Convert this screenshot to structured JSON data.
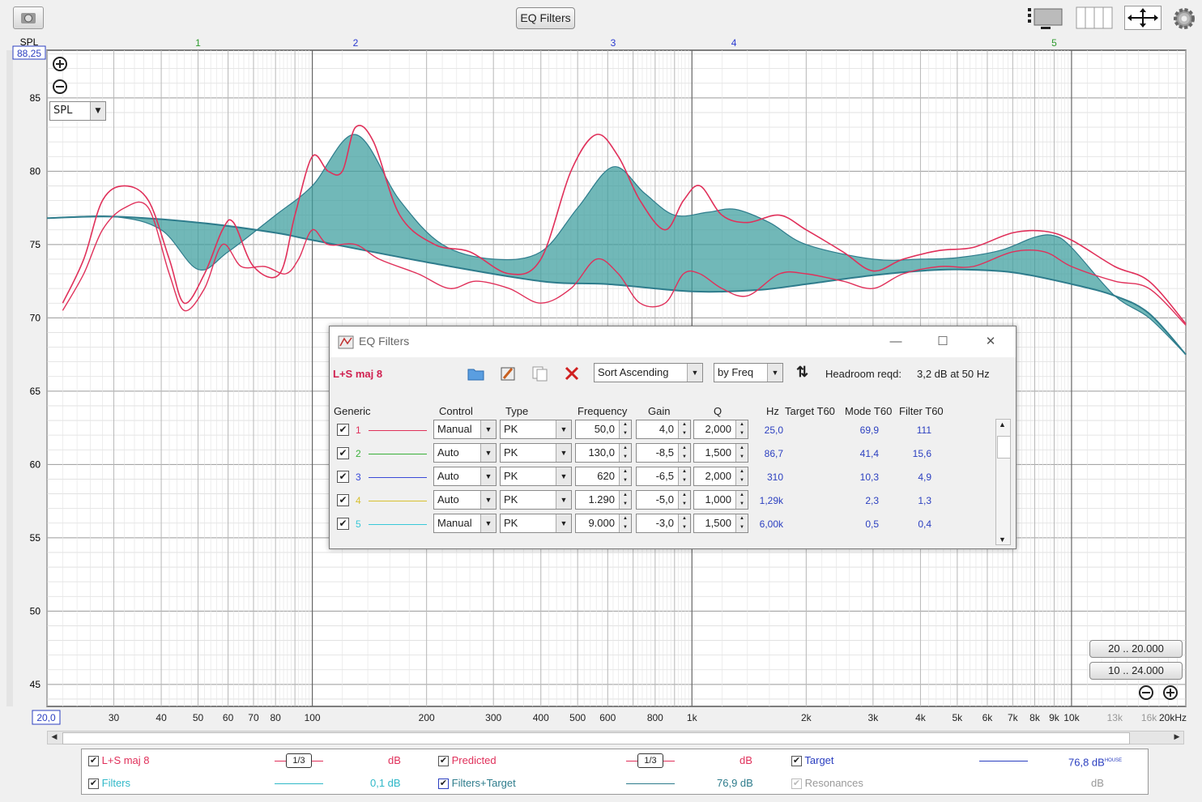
{
  "toolbar": {
    "eq_filters_label": "EQ Filters",
    "icons": [
      "camera-icon",
      "layout-icon",
      "columns-icon",
      "move-icon",
      "gear-icon"
    ]
  },
  "graph": {
    "spl_label": "SPL",
    "y_top_value": "88,25",
    "x_left_value": "20,0",
    "y_ticks": [
      "85",
      "80",
      "75",
      "70",
      "65",
      "60",
      "55",
      "50",
      "45"
    ],
    "x_ticks": [
      "30",
      "40",
      "50",
      "60",
      "70",
      "80",
      "100",
      "200",
      "300",
      "400",
      "500",
      "600",
      "800",
      "1k",
      "2k",
      "3k",
      "4k",
      "5k",
      "6k",
      "7k",
      "8k",
      "9k",
      "10k",
      "13k",
      "16k",
      "20kHz"
    ],
    "filter_markers": [
      {
        "label": "1",
        "hz": 50,
        "color": "#2e9a2e"
      },
      {
        "label": "2",
        "hz": 130,
        "color": "#2a3ad0"
      },
      {
        "label": "3",
        "hz": 620,
        "color": "#2a3ad0"
      },
      {
        "label": "4",
        "hz": 1290,
        "color": "#2a3ad0"
      },
      {
        "label": "5",
        "hz": 9000,
        "color": "#2e9a2e"
      }
    ],
    "mode_select": "SPL",
    "zoom_buttons": [
      "20 .. 20.000",
      "10 .. 24.000"
    ],
    "colors": {
      "measured": "#e0305a",
      "filled": "#3a9c9c",
      "target": "#2e7c8c"
    }
  },
  "chart_data": {
    "type": "line",
    "xlabel": "",
    "ylabel": "SPL",
    "xscale": "log",
    "xlim": [
      20,
      20000
    ],
    "ylim": [
      43.5,
      88.25
    ],
    "series": [
      {
        "name": "L+S maj 8",
        "points": [
          [
            22,
            71
          ],
          [
            25,
            74
          ],
          [
            28,
            78
          ],
          [
            32,
            79
          ],
          [
            37,
            78
          ],
          [
            42,
            74
          ],
          [
            46,
            71
          ],
          [
            52,
            73
          ],
          [
            58,
            76
          ],
          [
            62,
            76.5
          ],
          [
            70,
            73.5
          ],
          [
            82,
            73
          ],
          [
            90,
            77
          ],
          [
            100,
            81
          ],
          [
            110,
            80
          ],
          [
            120,
            80
          ],
          [
            130,
            83
          ],
          [
            145,
            82
          ],
          [
            170,
            77
          ],
          [
            210,
            75
          ],
          [
            260,
            74.5
          ],
          [
            330,
            73
          ],
          [
            400,
            74
          ],
          [
            480,
            80
          ],
          [
            560,
            82.5
          ],
          [
            640,
            81
          ],
          [
            730,
            78
          ],
          [
            850,
            76
          ],
          [
            950,
            78
          ],
          [
            1050,
            79
          ],
          [
            1200,
            77
          ],
          [
            1400,
            76.5
          ],
          [
            1700,
            77
          ],
          [
            2000,
            76
          ],
          [
            2500,
            74.5
          ],
          [
            3000,
            73.2
          ],
          [
            3600,
            74
          ],
          [
            4500,
            74.6
          ],
          [
            5500,
            74.8
          ],
          [
            7000,
            75.8
          ],
          [
            8500,
            75.9
          ],
          [
            10000,
            75.3
          ],
          [
            13000,
            73.5
          ],
          [
            16000,
            72.5
          ],
          [
            20000,
            69.6
          ]
        ]
      },
      {
        "name": "Predicted",
        "points": [
          [
            22,
            70.5
          ],
          [
            25,
            73
          ],
          [
            28,
            76
          ],
          [
            32,
            77.5
          ],
          [
            37,
            77.5
          ],
          [
            42,
            73
          ],
          [
            46,
            70.5
          ],
          [
            52,
            72
          ],
          [
            58,
            75
          ],
          [
            65,
            73.5
          ],
          [
            75,
            73.5
          ],
          [
            85,
            73
          ],
          [
            92,
            74
          ],
          [
            100,
            76
          ],
          [
            110,
            75
          ],
          [
            130,
            75
          ],
          [
            150,
            74
          ],
          [
            190,
            73
          ],
          [
            230,
            72
          ],
          [
            270,
            72.5
          ],
          [
            330,
            72
          ],
          [
            400,
            71
          ],
          [
            480,
            72
          ],
          [
            560,
            74
          ],
          [
            640,
            73
          ],
          [
            730,
            71
          ],
          [
            850,
            71
          ],
          [
            950,
            73
          ],
          [
            1050,
            73
          ],
          [
            1200,
            72
          ],
          [
            1400,
            71.5
          ],
          [
            1700,
            73
          ],
          [
            2000,
            73
          ],
          [
            2500,
            72.5
          ],
          [
            3000,
            72
          ],
          [
            3600,
            73
          ],
          [
            4500,
            73.5
          ],
          [
            5500,
            73.5
          ],
          [
            7000,
            74.5
          ],
          [
            8500,
            74.5
          ],
          [
            10000,
            73.5
          ],
          [
            13000,
            72.5
          ],
          [
            16000,
            72
          ],
          [
            20000,
            69.5
          ]
        ]
      },
      {
        "name": "Target",
        "points": [
          [
            20,
            76.8
          ],
          [
            30,
            76.9
          ],
          [
            50,
            76.5
          ],
          [
            80,
            75.8
          ],
          [
            100,
            75.3
          ],
          [
            200,
            73.8
          ],
          [
            400,
            72.5
          ],
          [
            600,
            72.3
          ],
          [
            1000,
            71.8
          ],
          [
            1500,
            71.9
          ],
          [
            2000,
            72.3
          ],
          [
            3000,
            72.9
          ],
          [
            4000,
            73.2
          ],
          [
            5000,
            73.3
          ],
          [
            7000,
            73.1
          ],
          [
            10000,
            72.3
          ],
          [
            13000,
            71.5
          ],
          [
            16000,
            70.3
          ],
          [
            20000,
            67.5
          ]
        ]
      },
      {
        "name": "Filters+Target",
        "points": [
          [
            20,
            76.8
          ],
          [
            30,
            76.9
          ],
          [
            40,
            76
          ],
          [
            50,
            73.3
          ],
          [
            60,
            74.5
          ],
          [
            80,
            77
          ],
          [
            100,
            79
          ],
          [
            130,
            82.5
          ],
          [
            170,
            78
          ],
          [
            220,
            75
          ],
          [
            300,
            74
          ],
          [
            400,
            74.5
          ],
          [
            500,
            77.5
          ],
          [
            620,
            80.3
          ],
          [
            750,
            78.5
          ],
          [
            900,
            77
          ],
          [
            1100,
            77.2
          ],
          [
            1300,
            77.4
          ],
          [
            1600,
            76.5
          ],
          [
            2000,
            75
          ],
          [
            3000,
            74
          ],
          [
            4000,
            74
          ],
          [
            5000,
            74.1
          ],
          [
            6500,
            74.6
          ],
          [
            8000,
            75.5
          ],
          [
            9000,
            75.6
          ],
          [
            10000,
            74.8
          ],
          [
            13000,
            71.5
          ],
          [
            16000,
            70
          ],
          [
            20000,
            67.5
          ]
        ]
      }
    ]
  },
  "dialog": {
    "title": "EQ Filters",
    "measurement": "L+S maj 8",
    "sort": "Sort Ascending",
    "by": "by Freq",
    "headroom_label": "Headroom reqd:",
    "headroom_value": "3,2 dB at 50 Hz",
    "headers": {
      "generic": "Generic",
      "control": "Control",
      "type": "Type",
      "frequency": "Frequency",
      "gain": "Gain",
      "q": "Q",
      "hz": "Hz",
      "target_t60": "Target T60",
      "mode_t60": "Mode T60",
      "filter_t60": "Filter T60"
    },
    "filters": [
      {
        "n": "1",
        "color": "#e0305a",
        "control": "Manual",
        "type": "PK",
        "freq": "50,0",
        "gain": "4,0",
        "q": "2,000",
        "hz": "25,0",
        "mode": "69,9",
        "filter": "111"
      },
      {
        "n": "2",
        "color": "#3ab03a",
        "control": "Auto",
        "type": "PK",
        "freq": "130,0",
        "gain": "-8,5",
        "q": "1,500",
        "hz": "86,7",
        "mode": "41,4",
        "filter": "15,6"
      },
      {
        "n": "3",
        "color": "#3a4ad8",
        "control": "Auto",
        "type": "PK",
        "freq": "620",
        "gain": "-6,5",
        "q": "2,000",
        "hz": "310",
        "mode": "10,3",
        "filter": "4,9"
      },
      {
        "n": "4",
        "color": "#d8c030",
        "control": "Auto",
        "type": "PK",
        "freq": "1.290",
        "gain": "-5,0",
        "q": "1,000",
        "hz": "1,29k",
        "mode": "2,3",
        "filter": "1,3"
      },
      {
        "n": "5",
        "color": "#38c8d8",
        "control": "Manual",
        "type": "PK",
        "freq": "9.000",
        "gain": "-3,0",
        "q": "1,500",
        "hz": "6,00k",
        "mode": "0,5",
        "filter": "0,4"
      }
    ]
  },
  "legend": {
    "row1": [
      {
        "name": "L+S maj 8",
        "color": "#e0305a",
        "smoothing": "1/3",
        "value": "dB"
      },
      {
        "name": "Predicted",
        "color": "#e0305a",
        "smoothing": "1/3",
        "value": "dB"
      },
      {
        "name": "Target",
        "color": "#2b3fc0",
        "value": "76,8 dB",
        "sup": "HOUSE"
      }
    ],
    "row2": [
      {
        "name": "Filters",
        "color": "#30b8c8",
        "value": "0,1 dB"
      },
      {
        "name": "Filters+Target",
        "color": "#2e7c8c",
        "value": "76,9 dB"
      },
      {
        "name": "Resonances",
        "color": "#999999",
        "value": "dB"
      }
    ]
  }
}
